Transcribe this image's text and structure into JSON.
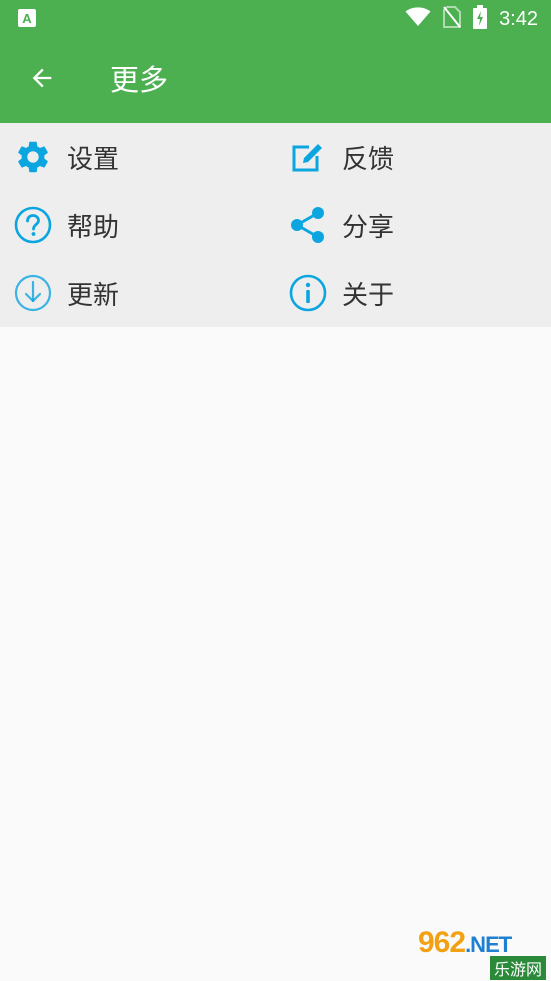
{
  "status_bar": {
    "time": "3:42",
    "icons": [
      "a-notification-icon",
      "wifi-icon",
      "no-sim-icon",
      "battery-charging-icon"
    ]
  },
  "app_bar": {
    "title": "更多",
    "back_icon": "arrow-left-icon",
    "background_color": "#4caf50"
  },
  "menu": {
    "accent_color": "#0ba5e0",
    "items": [
      {
        "label": "设置",
        "icon": "gear-icon"
      },
      {
        "label": "反馈",
        "icon": "edit-icon"
      },
      {
        "label": "帮助",
        "icon": "help-icon"
      },
      {
        "label": "分享",
        "icon": "share-icon"
      },
      {
        "label": "更新",
        "icon": "download-icon"
      },
      {
        "label": "关于",
        "icon": "info-icon"
      }
    ]
  },
  "watermark": {
    "brand": "962",
    "domain": ".NET",
    "subtitle": "乐游网"
  }
}
